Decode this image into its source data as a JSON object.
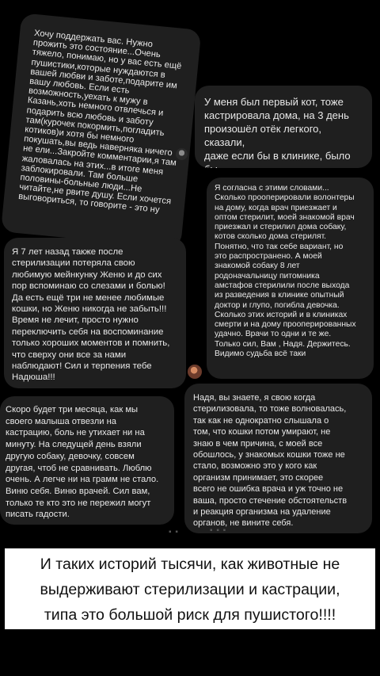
{
  "comments": {
    "c1": "Хочу поддержать вас. Нужно\nпрожить это состояние...Очень\nтяжело, понимаю, но у вас есть ещё\nпушистики,которые нуждаются в\nвашей любви и заботе,подарите им\nвашу любовь. Если есть\nвозможность,уехать к мужу в\nКазань,хоть немного отвлечься и\nподарить всю любовь и заботу\nтам(курочек покормить,погладить\nкотиков)и хотя бы немного\nпокушать,вы ведь наверняка ничего\nне ели...Закройте комментарии,я там\nжаловалась на этих...в итоге меня\nзаблокировали. Там больше\nполовины-больные люди...Не\nчитайте,не рвите душу. Если хочется\nвыговориться, то говорите - это ну",
    "c2": "У меня был первый кот, тоже\nкастрировала дома, на 3 день\nпроизошёл отёк легкого, сказали,\nдаже если бы в клинике, было бы\nтоже самое. Сил тебе...",
    "c3": "Я согласна с этими словами...\nСколько прооперировали волонтеры\nна дому, когда врач приезжает и\nоптом стерилит, моей знакомой врач\nприезжал и стерилил дома собаку,\nкотов сколько дома стерилят.\nПонятно, что так себе вариант, но\nэто распространено. А моей\nзнакомой собаку 8 лет\nродоначальницу питомника\nамстафов стерилили после выхода\nиз разведения в клинике опытный\nдоктор и глупо, погибла девочка.\nСколько этих историй и в клиниках\nсмерти и на дому прооперированных\nудачно. Врачи то одни и те же.\nТолько сил, Вам , Надя. Держитесь.\nВидимо судьба всё таки",
    "c4": "Я 7 лет назад также после\nстерилизации потеряла свою\nлюбимую мейнкунку Женю и до сих\nпор вспоминаю со слезами и болью!\nДа есть ещё три не менее любимые\nкошки,  но Женю никогда не забыть!!!\nВремя не лечит, просто нужно\nпереключить себя на воспоминание\nтолько хороших моментов и помнить,\nчто сверху они все за нами\nнаблюдают! Сил и терпения тебе\nНадюша!!!",
    "c5": "Скоро будет три месяца, как мы\nсвоего малыша отвезли на\nкастрацию, боль не утихает ни на\nминуту. На следущей день взяли\nдругую собаку, девочку, совсем\nдругая, чтоб не сравнивать. Люблю\nочень. А легче ни на грамм не стало.\nВиню себя. Виню врачей. Сил вам,\nтолько те кто это не пережил могут\nписать гадости.",
    "c6": "Надя, вы знаете, я свою когда\nстерилизовала, то тоже волновалась,\nтак как не однократно слышала о\nтом, что кошки потом умирают, не\nзнаю в чем причина, с моей все\nобошлось, у знакомых кошки тоже не\nстало, возможно это у кого как\nорганизм принимает, это скорее\nвсего не ошибка врача и уж точно не\nваша, просто стечение обстоятельств\nи реакция организма на удаление\nорганов, не вините себя."
  },
  "caption": "И таких историй тысячи, как животные не\nвыдерживают стерилизации и кастрации,\nтипа это большой риск для пушистого!!!!",
  "decor": {
    "dots_a": "▪ ▪",
    "dots_b": "▪ ▪ ▪"
  },
  "colors": {
    "background": "#000000",
    "bubble": "#1f1f1f",
    "caption_bg": "#ffffff"
  }
}
